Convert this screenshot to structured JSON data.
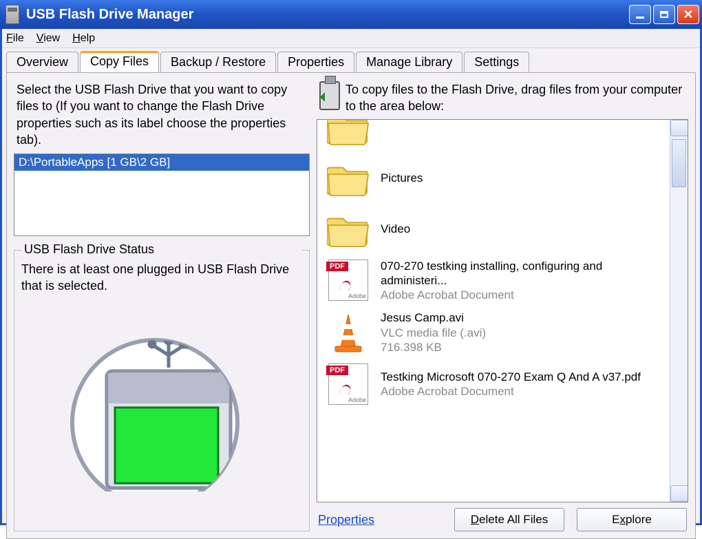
{
  "window": {
    "title": "USB Flash Drive Manager"
  },
  "menu": {
    "file": "File",
    "view": "View",
    "help": "Help"
  },
  "tabs": {
    "overview": "Overview",
    "copy": "Copy Files",
    "backup": "Backup / Restore",
    "properties": "Properties",
    "library": "Manage Library",
    "settings": "Settings",
    "selected": "copy"
  },
  "left": {
    "instructions": "Select the USB Flash Drive that you want to copy files to (If you want to change the Flash Drive properties such as its label choose the properties tab).",
    "drives": [
      {
        "label": "D:\\PortableApps [1 GB\\2 GB]",
        "selected": true
      }
    ],
    "status_title": "USB Flash Drive Status",
    "status_text": "There is at least one plugged in USB Flash Drive that is selected."
  },
  "right": {
    "hint": "To copy files to the Flash Drive, drag files from your computer to the area below:",
    "files": [
      {
        "type": "folder",
        "name": "",
        "sub1": "",
        "sub2": ""
      },
      {
        "type": "folder",
        "name": "Pictures",
        "sub1": "",
        "sub2": ""
      },
      {
        "type": "folder",
        "name": "Video",
        "sub1": "",
        "sub2": ""
      },
      {
        "type": "pdf",
        "name": "070-270 testking installing, configuring and administeri...",
        "sub1": "Adobe Acrobat Document",
        "sub2": ""
      },
      {
        "type": "avi",
        "name": "Jesus Camp.avi",
        "sub1": "VLC media file (.avi)",
        "sub2": "716.398 KB"
      },
      {
        "type": "pdf",
        "name": "Testking Microsoft 070-270 Exam Q And A v37.pdf",
        "sub1": "Adobe Acrobat Document",
        "sub2": ""
      }
    ],
    "properties_link": "Properties",
    "delete_btn": "Delete All Files",
    "explore_btn": "Explore"
  }
}
